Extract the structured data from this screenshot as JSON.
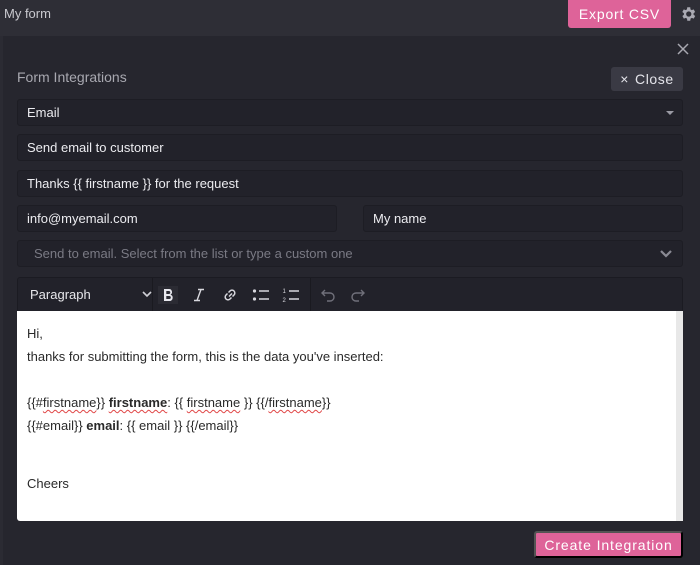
{
  "header": {
    "title": "My form",
    "export_label": "Export CSV",
    "settings_icon": "gear-icon"
  },
  "panel": {
    "close_icon": "close-icon",
    "section_title": "Form Integrations",
    "close_button_icon": "×",
    "close_button_label": "Close"
  },
  "form": {
    "type_select": {
      "value": "Email"
    },
    "name_field": {
      "value": "Send email to customer"
    },
    "subject_field": {
      "value": "Thanks {{ firstname }} for the request"
    },
    "from_email_field": {
      "value": "info@myemail.com"
    },
    "from_name_field": {
      "value": "My name"
    },
    "send_to_select": {
      "placeholder": "Send to email. Select from the list or type a custom one"
    }
  },
  "editor": {
    "toolbar": {
      "block_format": "Paragraph",
      "buttons": [
        "bold",
        "italic",
        "link",
        "bullet-list",
        "numbered-list",
        "undo",
        "redo"
      ]
    },
    "content": {
      "line1": "Hi,",
      "line2": "thanks for submitting the form, this is the data you've inserted:",
      "fn_open": "{{#firstname}}",
      "fn_label": "firstname",
      "fn_mid": ": {{ firstname }} ",
      "fn_close": "{{/firstname}}",
      "em_open": "{{#email}} ",
      "em_label": "email",
      "em_rest": ": {{ email }} {{/email}}",
      "sign_off": "Cheers"
    }
  },
  "footer": {
    "create_label": "Create Integration"
  },
  "colors": {
    "accent": "#de6399",
    "background": "#26262e"
  }
}
